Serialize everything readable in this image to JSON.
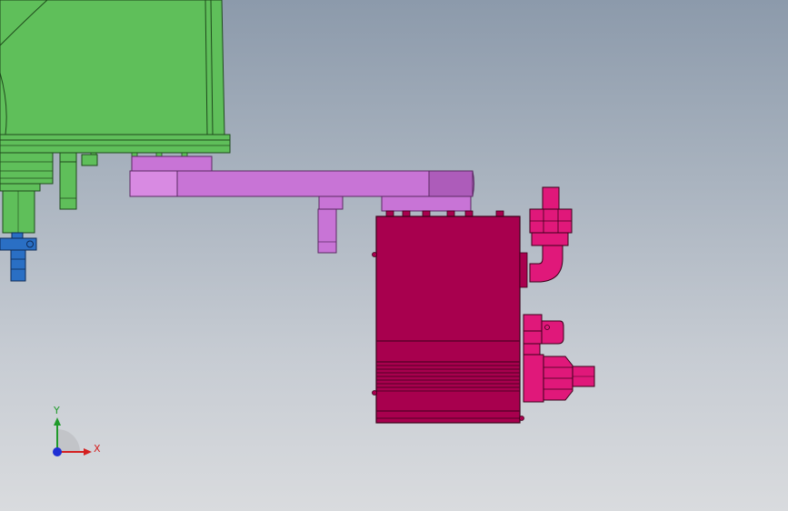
{
  "viewport": {
    "background_top": "#8c9aab",
    "background_bottom": "#d9dbde"
  },
  "colors": {
    "green_base": "#5fbf5a",
    "green_edge": "#1f4a1c",
    "violet_arm": "#c874d6",
    "violet_edge": "#5a2a63",
    "magenta_box": "#a8004e",
    "magenta_fitting": "#e0187a",
    "blue_part": "#2a6fc4"
  },
  "triad": {
    "x_label": "X",
    "y_label": "Y",
    "x_color": "#d42020",
    "y_color": "#1f9a2a",
    "z_color": "#1f2fd4"
  }
}
